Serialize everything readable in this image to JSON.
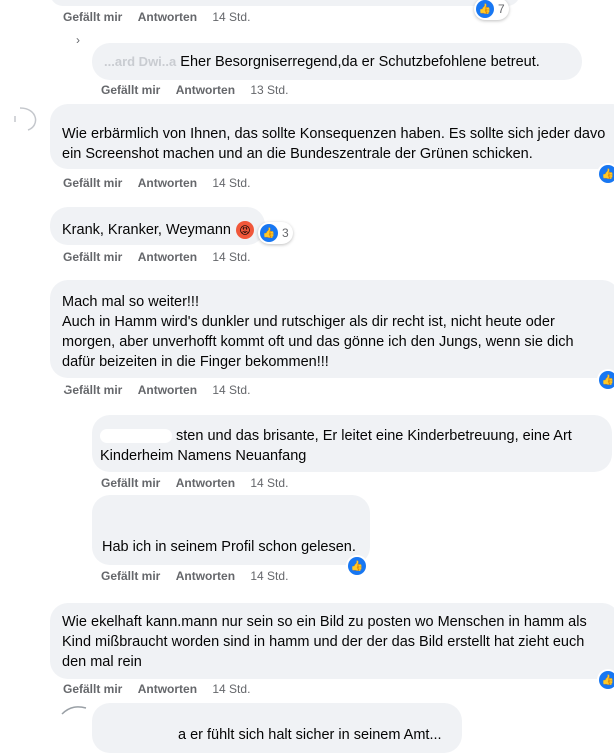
{
  "actions": {
    "like": "Gefällt mir",
    "reply": "Antworten"
  },
  "comments": [
    {
      "time": "14 Std.",
      "reaction_count": "7"
    },
    {
      "partial_name": "...ard Dwi..a",
      "text": "Eher Besorgniserregend,da er Schutzbefohlene betreut.",
      "time": "13 Std."
    },
    {
      "line1": "Wie erbärmlich von Ihnen, das sollte Konsequenzen haben. Es sollte sich jeder davo",
      "line2": "ein Screenshot machen und an die Bundeszentrale der Grünen schicken.",
      "time": "14 Std."
    },
    {
      "text": "Krank, Kranker, Weymann",
      "reaction_count": "3",
      "time": "14 Std."
    },
    {
      "line1": "Mach mal so weiter!!!",
      "line2": "Auch in Hamm wird's dunkler und rutschiger als dir recht ist, nicht heute oder",
      "line3": "morgen, aber unverhofft kommt oft und das gönne ich den Jungs, wenn sie dich",
      "line4": "dafür beizeiten in die Finger bekommen!!!",
      "time": "14 Std."
    },
    {
      "line1": "sten und das brisante, Er leitet eine Kinderbetreuung, eine Art",
      "line2": "Kinderheim Namens Neuanfang",
      "time": "14 Std."
    },
    {
      "text": "Hab ich in seinem Profil schon gelesen.",
      "time": "14 Std."
    },
    {
      "line1": "Wie ekelhaft kann.mann nur sein so ein Bild zu posten wo Menschen in hamm als",
      "line2": "Kind mißbraucht worden sind in hamm und der der das Bild erstellt hat zieht euch",
      "line3": "den mal rein",
      "time": "14 Std."
    },
    {
      "text": "a er fühlt sich halt sicher in seinem Amt..."
    }
  ],
  "icons": {
    "like": "thumbs-up-icon",
    "angry": "angry-face-icon"
  }
}
